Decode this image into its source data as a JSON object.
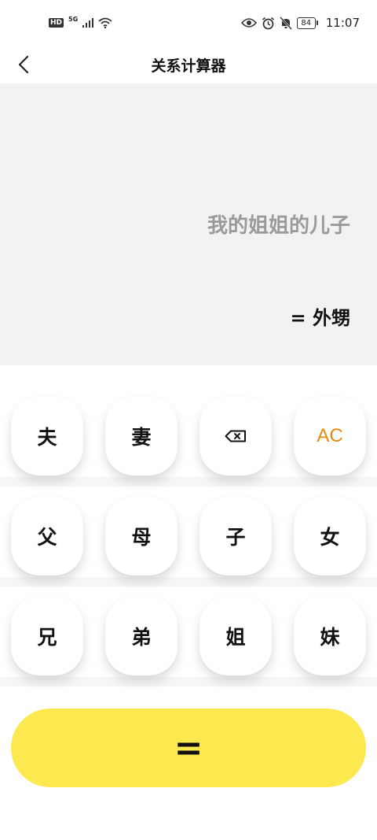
{
  "status_bar": {
    "hd": "HD",
    "network": "5G",
    "battery": "84",
    "time": "11:07"
  },
  "header": {
    "title": "关系计算器"
  },
  "display": {
    "expression": "我的姐姐的儿子",
    "result": "= 外甥"
  },
  "keypad": {
    "row1": [
      "夫",
      "妻",
      "",
      "AC"
    ],
    "row2": [
      "父",
      "母",
      "子",
      "女"
    ],
    "row3": [
      "兄",
      "弟",
      "姐",
      "妹"
    ]
  },
  "equals_label": "=",
  "colors": {
    "accent_yellow": "#fce84f",
    "ac_orange": "#e58a12",
    "display_bg": "#f2f2f2",
    "expression_gray": "#9a9a9a"
  },
  "icons": [
    "back-icon",
    "eye-icon",
    "alarm-icon",
    "mute-icon",
    "wifi-icon",
    "signal-icon",
    "backspace-icon"
  ]
}
